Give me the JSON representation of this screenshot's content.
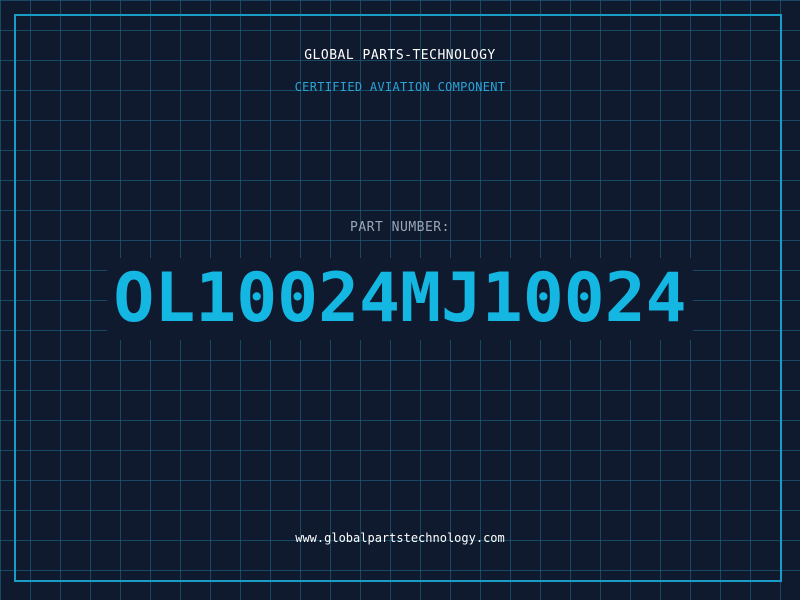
{
  "company_name": "GLOBAL PARTS-TECHNOLOGY",
  "tagline": "CERTIFIED AVIATION COMPONENT",
  "part_number_label": "PART NUMBER:",
  "part_number": "OL10024MJ10024",
  "website": "www.globalpartstechnology.com",
  "colors": {
    "background": "#0f1a2e",
    "grid": "#206e8c",
    "frame": "#1a9cc8",
    "accent": "#14b6e2",
    "label": "#9aa7b8",
    "text": "#ffffff"
  }
}
